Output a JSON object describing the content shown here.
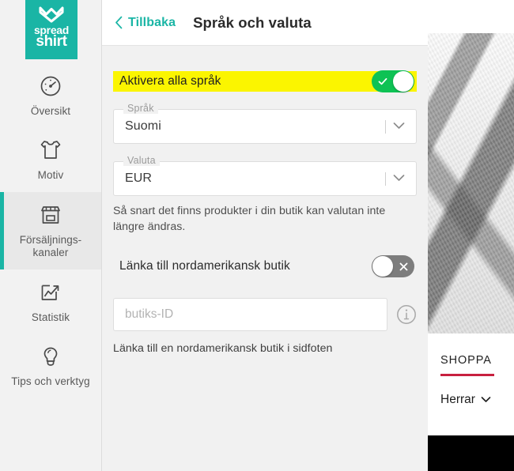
{
  "brand": {
    "logo_line1": "spread",
    "logo_line2": "shirt",
    "logo_color": "#1ab5a5",
    "logo_icon": "heart-icon"
  },
  "sidebar": {
    "items": [
      {
        "label": "Översikt",
        "icon": "speedometer-icon",
        "active": false
      },
      {
        "label": "Motiv",
        "icon": "tshirt-icon",
        "active": false
      },
      {
        "label": "Försäljnings-\nkanaler",
        "icon": "storefront-icon",
        "active": true
      },
      {
        "label": "Statistik",
        "icon": "chart-arrow-icon",
        "active": false
      },
      {
        "label": "Tips och verktyg",
        "icon": "lightbulb-icon",
        "active": false
      }
    ]
  },
  "header": {
    "back_label": "Tillbaka",
    "back_icon": "chevron-left-icon",
    "title": "Språk och valuta",
    "accent_color": "#1ab5a5"
  },
  "form": {
    "enable_all_languages": {
      "label": "Aktivera alla språk",
      "state": "on",
      "icon": "check-icon",
      "highlight_color": "#fbf500",
      "on_color": "#0ec254"
    },
    "language_field": {
      "label": "Språk",
      "value": "Suomi",
      "icon": "chevron-down-icon"
    },
    "currency_field": {
      "label": "Valuta",
      "value": "EUR",
      "icon": "chevron-down-icon"
    },
    "currency_helper": "Så snart det finns produkter i din butik kan valutan inte längre ändras.",
    "link_na_shop": {
      "label": "Länka till nordamerikansk butik",
      "state": "off",
      "icon": "close-icon",
      "off_color": "#7d7d7d"
    },
    "shop_id_input": {
      "placeholder": "butiks-ID",
      "value": "",
      "info_icon": "info-icon"
    },
    "shop_id_caption": "Länka till en nordamerikansk butik i sidfoten"
  },
  "preview": {
    "hero_image": "grayscale-fabric-photo",
    "shop_label": "SHOPPA",
    "underline_color": "#c8203f",
    "category_label": "Herrar",
    "category_icon": "chevron-down-icon"
  }
}
